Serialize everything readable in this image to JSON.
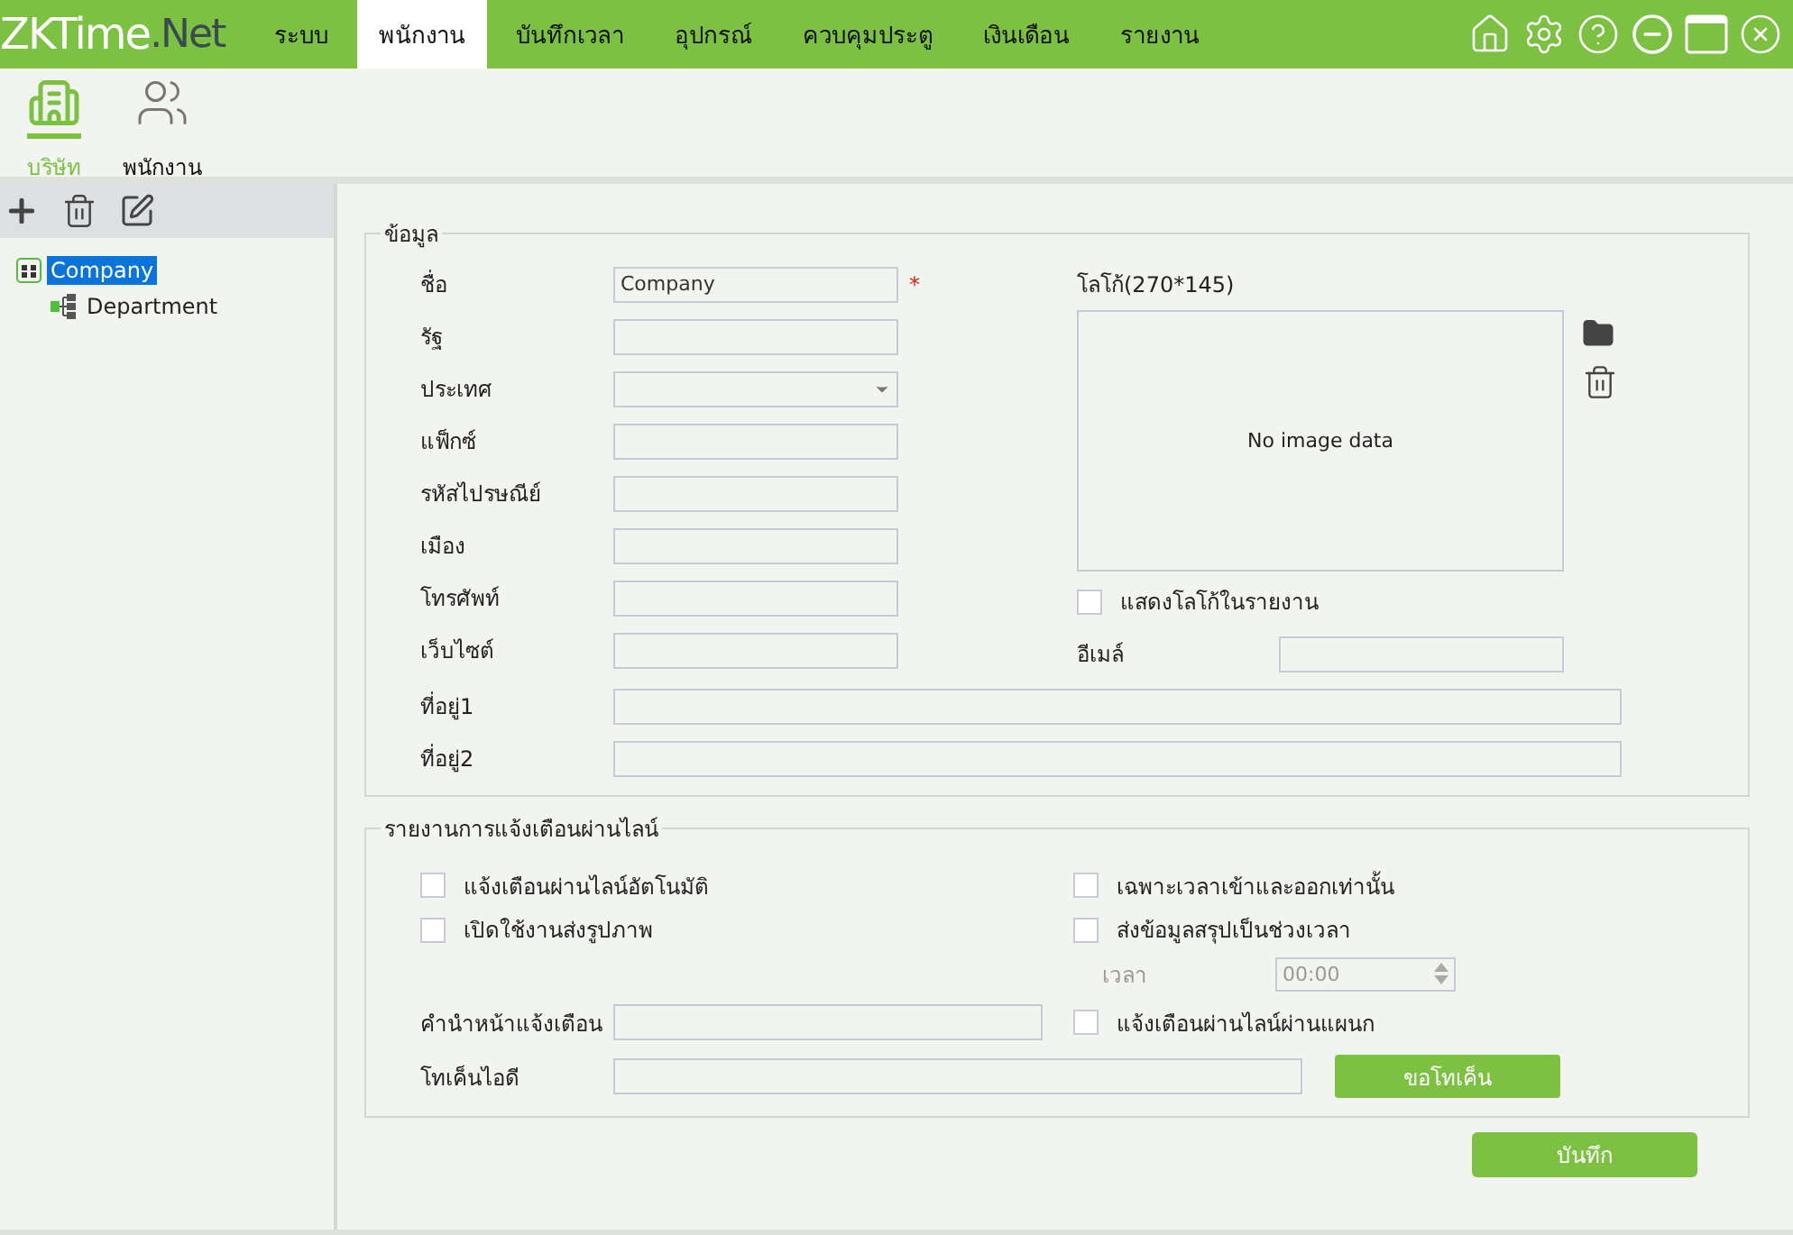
{
  "app": {
    "logo_main": "ZKTime",
    "logo_suffix": ".Net"
  },
  "menu": [
    {
      "label": "ระบบ",
      "selected": false
    },
    {
      "label": "พนักงาน",
      "selected": true
    },
    {
      "label": "บันทึกเวลา",
      "selected": false
    },
    {
      "label": "อุปกรณ์",
      "selected": false
    },
    {
      "label": "ควบคุมประตู",
      "selected": false
    },
    {
      "label": "เงินเดือน",
      "selected": false
    },
    {
      "label": "รายงาน",
      "selected": false
    }
  ],
  "subnav": [
    {
      "label": "บริษัท",
      "kind": "company",
      "selected": true
    },
    {
      "label": "พนักงาน",
      "kind": "people",
      "selected": false
    }
  ],
  "tree": [
    {
      "label": "Company",
      "selected": true,
      "children": [
        {
          "label": "Department",
          "selected": false
        }
      ]
    }
  ],
  "info": {
    "legend": "ข้อมูล",
    "fields": [
      {
        "label": "ชื่อ",
        "kind": "text",
        "value": "Company",
        "required": true
      },
      {
        "label": "รัฐ",
        "kind": "text",
        "required": false
      },
      {
        "label": "ประเทศ",
        "kind": "select",
        "required": false
      },
      {
        "label": "แฟ็กซ์",
        "kind": "text",
        "required": false
      },
      {
        "label": "รหัสไปรษณีย์",
        "kind": "text",
        "required": false
      },
      {
        "label": "เมือง",
        "kind": "text",
        "required": false
      },
      {
        "label": "โทรศัพท์",
        "kind": "text",
        "required": false
      },
      {
        "label": "เว็บไซต์",
        "kind": "text",
        "required": false
      }
    ],
    "required_mark": "*",
    "logo_label": "โลโก้(270*145)",
    "logo_empty": "No image data",
    "show_logo": {
      "label": "แสดงโลโก้ในรายงาน",
      "checked": false
    },
    "email": {
      "label": "อีเมล์"
    },
    "addresses": [
      {
        "label": "ที่อยู่1"
      },
      {
        "label": "ที่อยู่2"
      }
    ]
  },
  "notify": {
    "legend": "รายงานการแจ้งเตือนผ่านไลน์",
    "options": [
      {
        "label": "แจ้งเตือนผ่านไลน์อัตโนมัติ",
        "checked": false
      },
      {
        "label": "เฉพาะเวลาเข้าและออกเท่านั้น",
        "checked": false
      },
      {
        "label": "เปิดใช้งานส่งรูปภาพ",
        "checked": false
      },
      {
        "label": "ส่งข้อมูลสรุปเป็นช่วงเวลา",
        "checked": false
      }
    ],
    "time": {
      "label": "เวลา",
      "value": "00:00",
      "disabled": true
    },
    "prefix": {
      "label": "คำนำหน้าแจ้งเตือน"
    },
    "dept_option": {
      "label": "แจ้งเตือนผ่านไลน์ผ่านแผนก",
      "checked": false
    },
    "token": {
      "label": "โทเค็นไอดี"
    },
    "token_button": "ขอโทเค็น"
  },
  "save_button": "บันทึก"
}
